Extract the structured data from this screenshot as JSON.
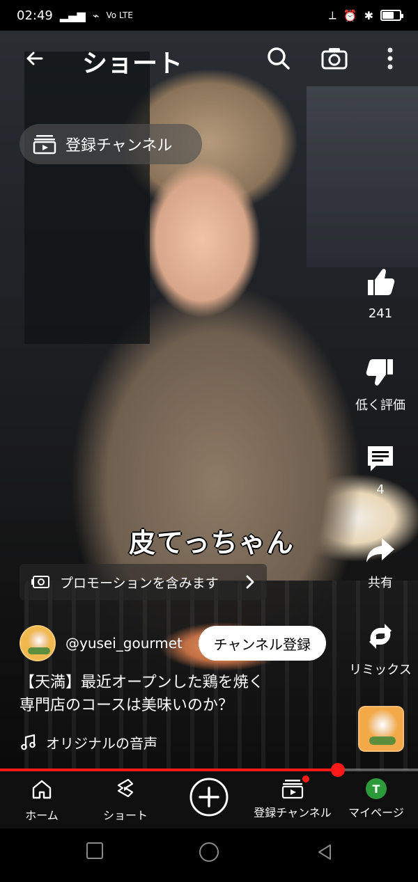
{
  "status_bar": {
    "time": "02:49",
    "network_label": "Vo LTE"
  },
  "top_bar": {
    "title": "ショート"
  },
  "subscriptions_chip": {
    "label": "登録チャンネル"
  },
  "video": {
    "overlay_text": "皮てっちゃん"
  },
  "promotion": {
    "label": "プロモーションを含みます"
  },
  "actions": {
    "like_count": "241",
    "dislike_label": "低く評価",
    "comment_count": "4",
    "share_label": "共有",
    "remix_label": "リミックス"
  },
  "channel": {
    "handle": "@yusei_gourmet",
    "subscribe_label": "チャンネル登録"
  },
  "caption": {
    "line1": "【天満】最近オープンした鶏を焼く",
    "line2": "専門店のコースは美味いのか？"
  },
  "audio": {
    "label": "オリジナルの音声"
  },
  "progress": {
    "fraction": 0.808
  },
  "bottom_nav": {
    "home": "ホーム",
    "shorts": "ショート",
    "subscriptions": "登録チャンネル",
    "me": "マイページ",
    "me_avatar_letter": "T"
  },
  "colors": {
    "accent_red": "#ff1a1a",
    "subscribe_bg": "#ffffff",
    "nav_bg": "#0f0f0f",
    "avatar_green": "#2d9a3a"
  }
}
